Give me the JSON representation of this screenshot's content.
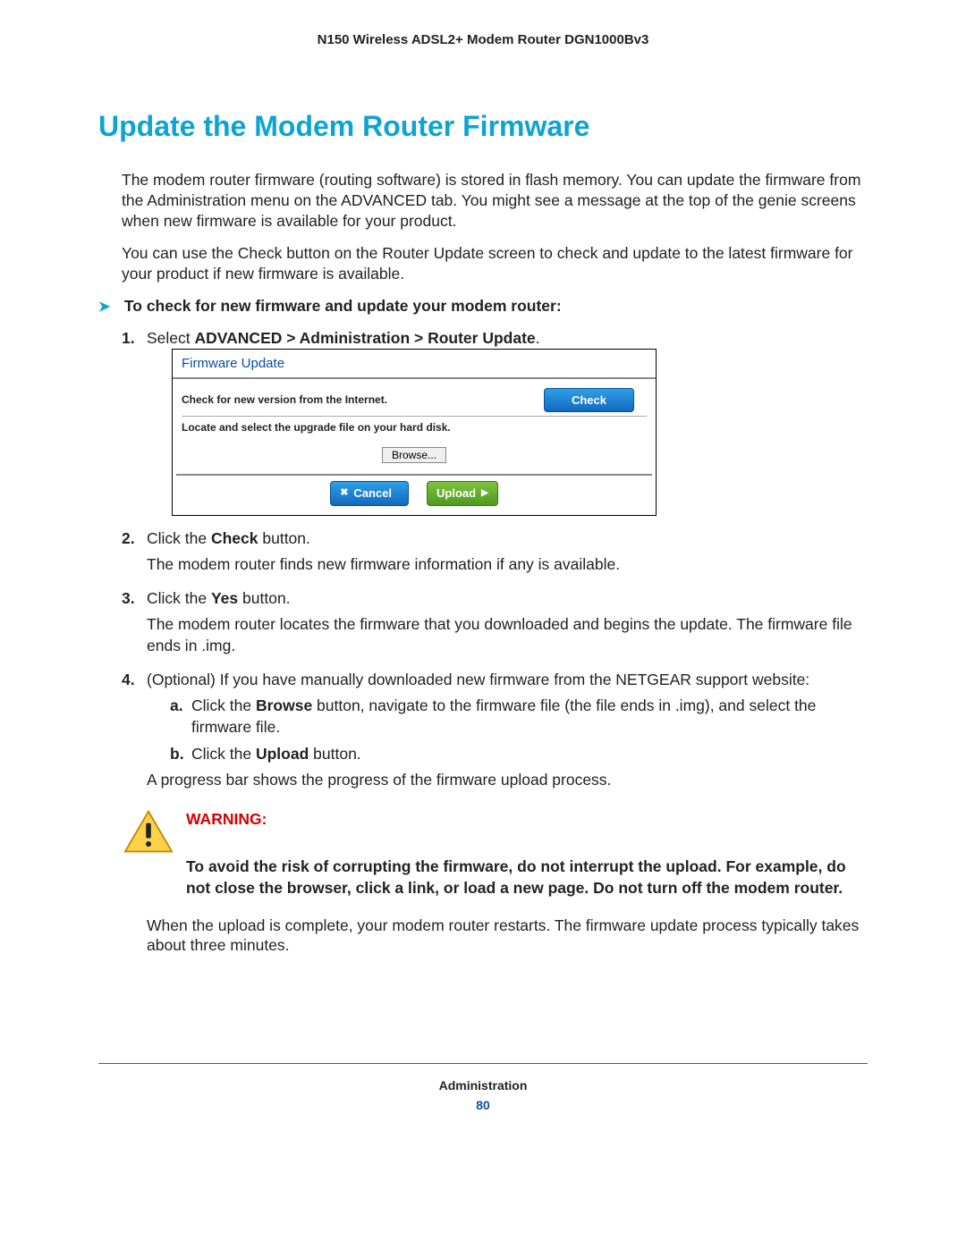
{
  "header": {
    "product": "N150 Wireless ADSL2+ Modem Router DGN1000Bv3"
  },
  "title": "Update the Modem Router Firmware",
  "para1": "The modem router firmware (routing software) is stored in flash memory. You can update the firmware from the Administration menu on the ADVANCED tab. You might see a message at the top of the genie screens when new firmware is available for your product.",
  "para2": "You can use the Check button on the Router Update screen to check and update to the latest firmware for your product if new firmware is available.",
  "task_heading": "To check for new firmware and update your modem router:",
  "step1_a": "Select ",
  "step1_b": "ADVANCED > Administration > Router Update",
  "step1_c": ".",
  "fw": {
    "title": "Firmware Update",
    "check_label": "Check for new version from the Internet.",
    "check_btn": "Check",
    "browse_label": "Locate and select the upgrade file on your hard disk.",
    "browse_btn": "Browse...",
    "cancel_btn": "Cancel",
    "upload_btn": "Upload"
  },
  "step2_a": "Click the ",
  "step2_b": "Check",
  "step2_c": " button.",
  "step2_p": "The modem router finds new firmware information if any is available.",
  "step3_a": "Click the ",
  "step3_b": "Yes",
  "step3_c": " button.",
  "step3_p": "The modem router locates the firmware that you downloaded and begins the update. The firmware file ends in .img.",
  "step4": "(Optional) If you have manually downloaded new firmware from the NETGEAR support website:",
  "step4a_a": "Click the ",
  "step4a_b": "Browse",
  "step4a_c": " button, navigate to the firmware file (the file ends in .img), and select the firmware file.",
  "step4b_a": "Click the ",
  "step4b_b": "Upload",
  "step4b_c": " button.",
  "step4_p": "A progress bar shows the progress of the firmware upload process.",
  "warning": {
    "label": "WARNING:",
    "text": "To avoid the risk of corrupting the firmware, do not interrupt the upload. For example, do not close the browser, click a link, or load a new page. Do not turn off the modem router."
  },
  "closing": "When the upload is complete, your modem router restarts. The firmware update process typically takes about three minutes.",
  "footer": {
    "section": "Administration",
    "page": "80"
  }
}
